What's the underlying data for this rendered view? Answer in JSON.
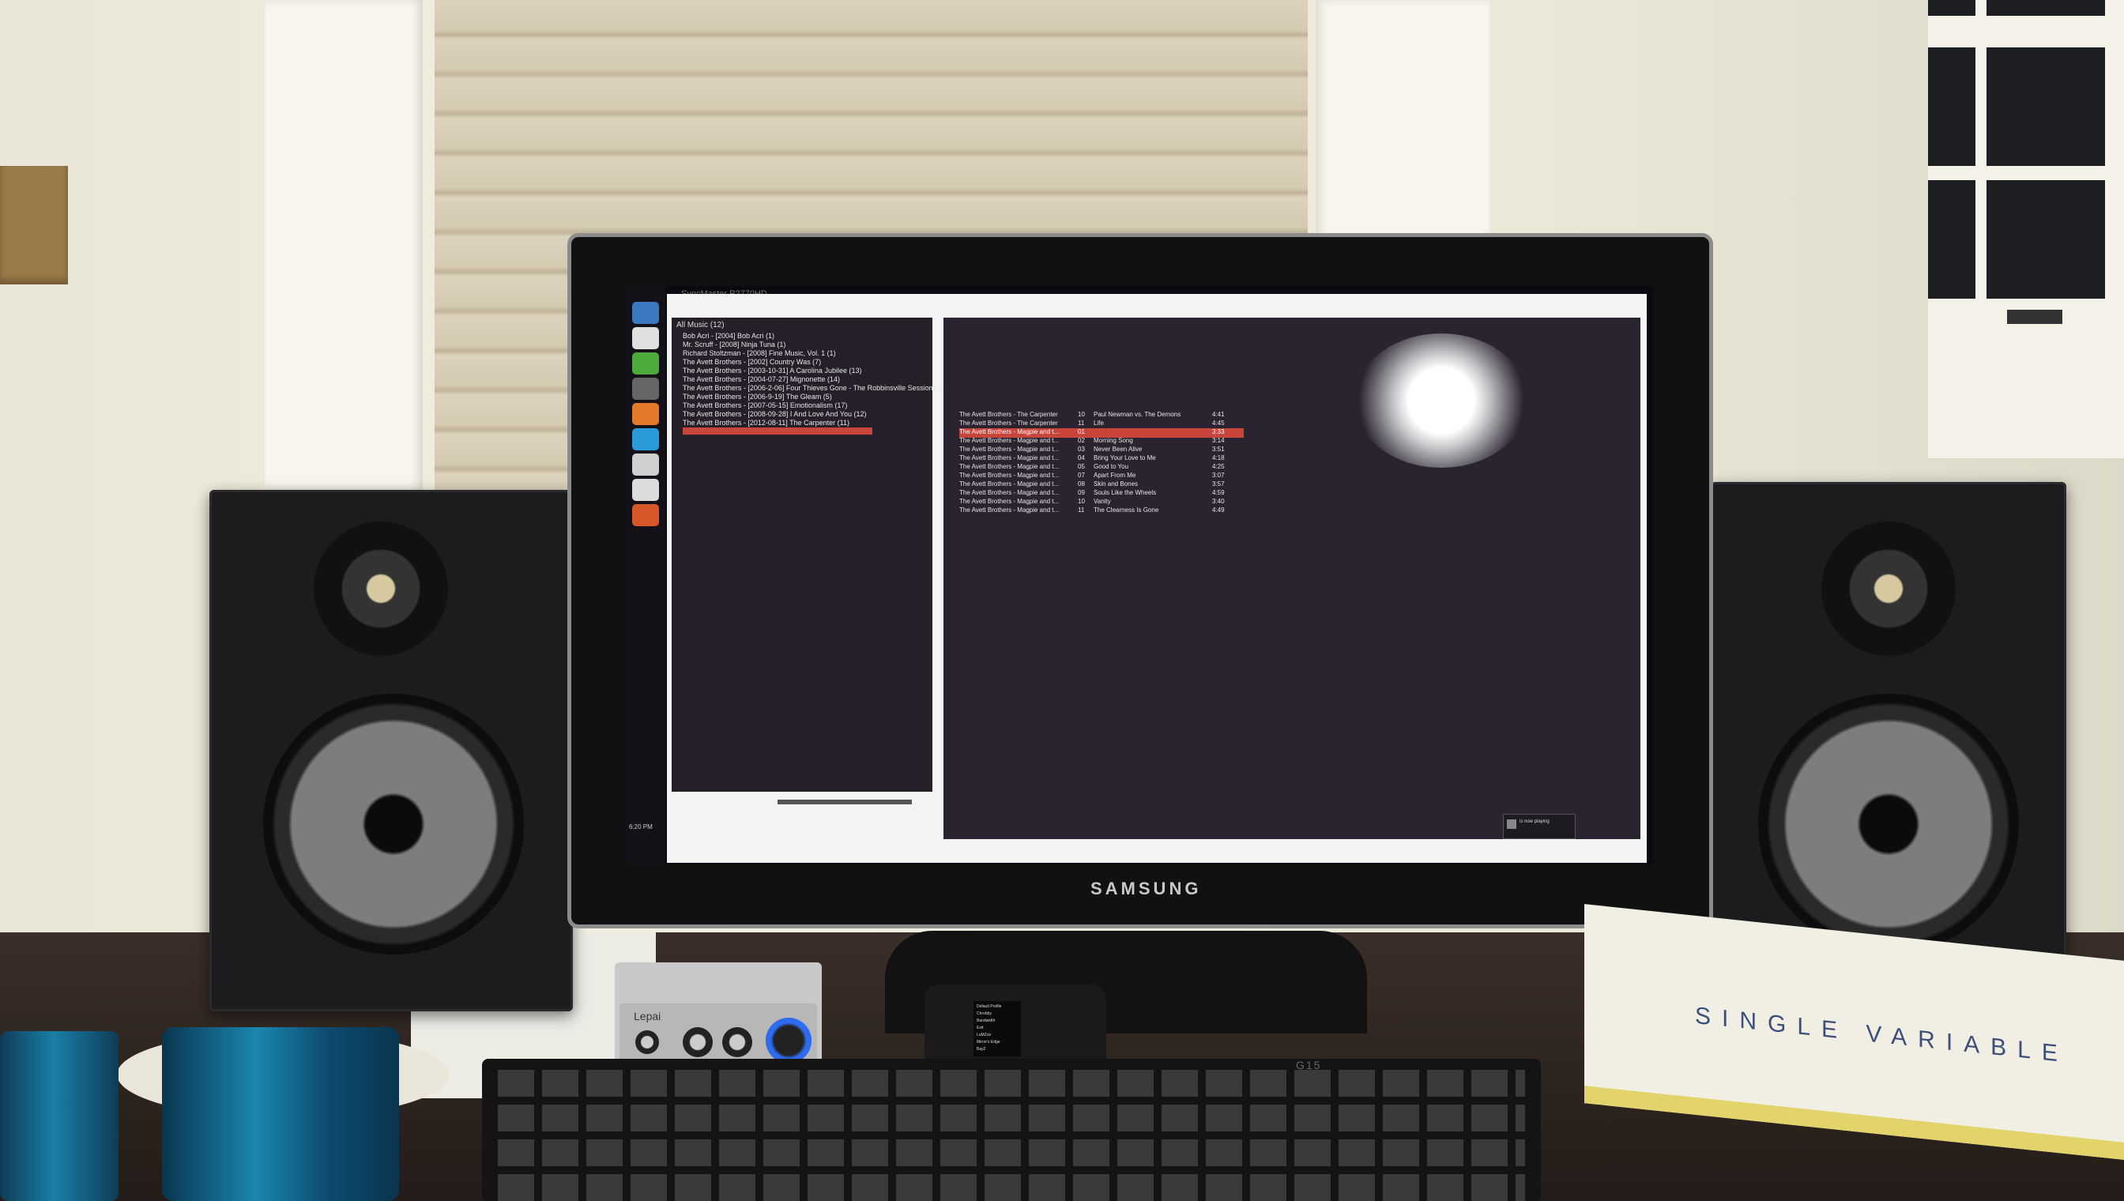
{
  "photo": {
    "subject": "desk setup with monitor, bookshelf speakers, amplifier and keyboard"
  },
  "monitor": {
    "brand": "SAMSUNG",
    "app_title": "SyncMaster P2770HD",
    "app_status": "",
    "library_root": "All Music (12)",
    "albums": [
      "Bob Acri - [2004] Bob Acri (1)",
      "Mr. Scruff - [2008] Ninja Tuna (1)",
      "Richard Stoltzman - [2008] Fine Music, Vol. 1 (1)",
      "The Avett Brothers - [2002] Country Was (7)",
      "The Avett Brothers - [2003-10-31] A Carolina Jubilee (13)",
      "The Avett Brothers - [2004-07-27] Mignonette (14)",
      "The Avett Brothers - [2006-2-06] Four Thieves Gone - The Robbinsville Sessions (14)",
      "The Avett Brothers - [2006-9-19] The Gleam (5)",
      "The Avett Brothers - [2007-05-15] Emotionalism (17)",
      "The Avett Brothers - [2008-09-28] I And Love And You (12)",
      "The Avett Brothers - [2012-08-11] The Carpenter (11)"
    ],
    "tracks": [
      {
        "artist": "The Avett Brothers - The Carpenter",
        "no": "10",
        "title": "Paul Newman vs. The Demons",
        "time": "4:41"
      },
      {
        "artist": "The Avett Brothers - The Carpenter",
        "no": "11",
        "title": "Life",
        "time": "4:45"
      },
      {
        "artist": "The Avett Brothers - Magpie and t...",
        "no": "01",
        "title": "",
        "time": "3:33"
      },
      {
        "artist": "The Avett Brothers - Magpie and t...",
        "no": "02",
        "title": "Morning Song",
        "time": "3:14"
      },
      {
        "artist": "The Avett Brothers - Magpie and t...",
        "no": "03",
        "title": "Never Been Alive",
        "time": "3:51"
      },
      {
        "artist": "The Avett Brothers - Magpie and t...",
        "no": "04",
        "title": "Bring Your Love to Me",
        "time": "4:18"
      },
      {
        "artist": "The Avett Brothers - Magpie and t...",
        "no": "05",
        "title": "Good to You",
        "time": "4:25"
      },
      {
        "artist": "The Avett Brothers - Magpie and t...",
        "no": "07",
        "title": "Apart From Me",
        "time": "3:07"
      },
      {
        "artist": "The Avett Brothers - Magpie and t...",
        "no": "08",
        "title": "Skin and Bones",
        "time": "3:57"
      },
      {
        "artist": "The Avett Brothers - Magpie and t...",
        "no": "09",
        "title": "Souls Like the Wheels",
        "time": "4:59"
      },
      {
        "artist": "The Avett Brothers - Magpie and t...",
        "no": "10",
        "title": "Vanity",
        "time": "3:40"
      },
      {
        "artist": "The Avett Brothers - Magpie and t...",
        "no": "11",
        "title": "The Clearness Is Gone",
        "time": "4:49"
      }
    ],
    "notification": "is now playing",
    "clock": "6:20 PM"
  },
  "amp": {
    "brand": "Lepai"
  },
  "dac": {
    "menu": [
      "Default Profile",
      "Chrobby",
      "Bandwidth",
      "Exit",
      "LuMZoo",
      "Mirror's Edge",
      "Bay2"
    ]
  },
  "keyboard": {
    "model": "G15"
  },
  "book": {
    "title": "SINGLE VARIABLE"
  }
}
